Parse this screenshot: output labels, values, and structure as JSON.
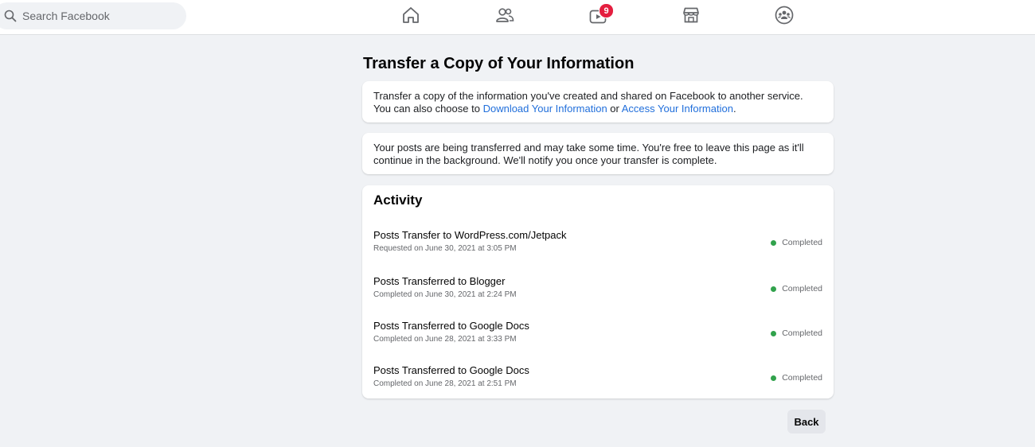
{
  "search": {
    "placeholder": "Search Facebook"
  },
  "nav": {
    "items": [
      {
        "icon": "home-icon"
      },
      {
        "icon": "friends-icon"
      },
      {
        "icon": "watch-icon",
        "badge": "9"
      },
      {
        "icon": "marketplace-icon"
      },
      {
        "icon": "groups-icon"
      }
    ]
  },
  "page": {
    "title": "Transfer a Copy of Your Information"
  },
  "intro": {
    "line1": "Transfer a copy of the information you've created and shared on Facebook to another service.",
    "line2_prefix": "You can also choose to ",
    "link_download": "Download Your Information",
    "connector": " or ",
    "link_access": "Access Your Information",
    "line2_suffix": "."
  },
  "notice": {
    "text": "Your posts are being transferred and may take some time. You're free to leave this page as it'll continue in the background. We'll notify you once your transfer is complete."
  },
  "activity": {
    "title": "Activity",
    "items": [
      {
        "title": "Posts Transfer to WordPress.com/Jetpack",
        "subtitle": "Requested on June 30, 2021 at 3:05 PM",
        "status": "Completed"
      },
      {
        "title": "Posts Transferred to Blogger",
        "subtitle": "Completed on June 30, 2021 at 2:24 PM",
        "status": "Completed"
      },
      {
        "title": "Posts Transferred to Google Docs",
        "subtitle": "Completed on June 28, 2021 at 3:33 PM",
        "status": "Completed"
      },
      {
        "title": "Posts Transferred to Google Docs",
        "subtitle": "Completed on June 28, 2021 at 2:51 PM",
        "status": "Completed"
      }
    ]
  },
  "footer": {
    "back_label": "Back"
  },
  "colors": {
    "status_complete": "#31a24c",
    "link": "#216fdb",
    "badge": "#e41e3f"
  }
}
